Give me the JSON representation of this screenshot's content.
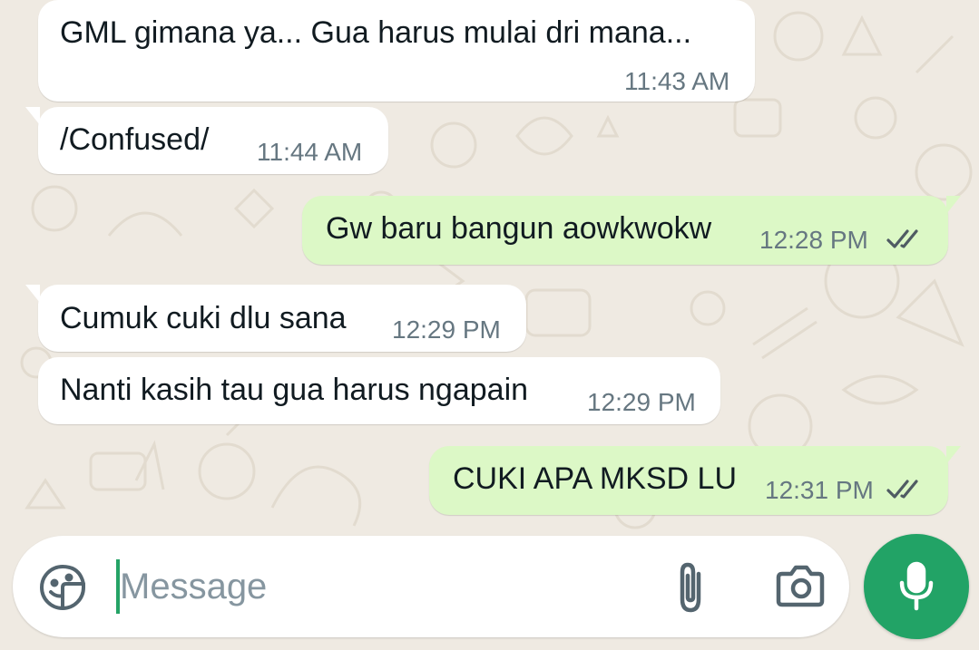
{
  "theme": {
    "incoming_bubble": "#ffffff",
    "outgoing_bubble": "#dcf8c6",
    "timestamp": "#667781",
    "read_ticks": "#4f5b63",
    "mic_button": "#22a366",
    "cursor": "#25a366",
    "wallpaper": "#efeae2"
  },
  "messages": [
    {
      "direction": "in",
      "text": "GML gimana ya... Gua harus  mulai dri mana...",
      "time": "11:43 AM"
    },
    {
      "direction": "in",
      "text": "/Confused/",
      "time": "11:44 AM"
    },
    {
      "direction": "out",
      "text": "Gw baru bangun aowkwokw",
      "time": "12:28 PM",
      "status_icon": "double-check-icon"
    },
    {
      "direction": "in",
      "text": "Cumuk cuki dlu sana",
      "time": "12:29 PM"
    },
    {
      "direction": "in",
      "text": "Nanti kasih tau gua harus ngapain",
      "time": "12:29 PM"
    },
    {
      "direction": "out",
      "text": "CUKI APA MKSD LU",
      "time": "12:31 PM",
      "status_icon": "double-check-icon"
    }
  ],
  "composer": {
    "placeholder": "Message",
    "value": "",
    "emoji_icon": "sticker-icon",
    "attach_icon": "paperclip-icon",
    "camera_icon": "camera-icon",
    "mic_icon": "microphone-icon"
  }
}
